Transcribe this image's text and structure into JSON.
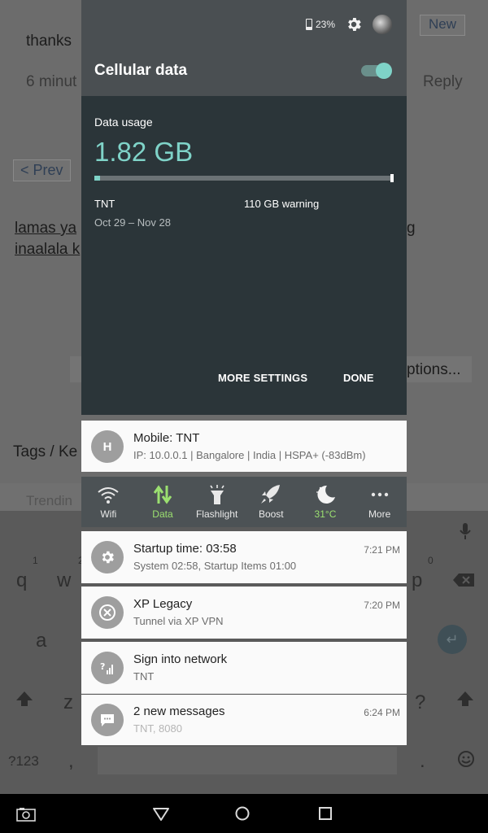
{
  "background": {
    "thanks": "thanks",
    "time_ago": "6 minut",
    "reply": "Reply",
    "new_btn": "New",
    "prev_btn": "< Prev",
    "line1_a": "lamas ya",
    "line1_b": "g",
    "line2_a": "inaalala k",
    "options": "ptions...",
    "tags": "Tags  /  Ke",
    "trending": "Trendin",
    "keyboard": {
      "row1": [
        "q",
        "w",
        "p"
      ],
      "row1_nums": [
        "1",
        "2",
        "0"
      ],
      "row2": [
        "a"
      ],
      "row3": [
        "z",
        "?"
      ],
      "row4": [
        "?123",
        ",",
        "."
      ]
    }
  },
  "status": {
    "battery_pct": "23%",
    "battery_level": 0.23
  },
  "cellular": {
    "title": "Cellular data",
    "toggle_on": true,
    "usage_label": "Data usage",
    "usage_value": "1.82 GB",
    "usage_fraction": 0.02,
    "carrier": "TNT",
    "warning": "110 GB warning",
    "period": "Oct 29 – Nov 28",
    "more_settings": "MORE SETTINGS",
    "done": "DONE"
  },
  "notif_mobile": {
    "icon_letter": "H",
    "title": "Mobile: TNT",
    "subtitle": "IP: 10.0.0.1 | Bangalore | India | HSPA+ (-83dBm)"
  },
  "tiles": [
    {
      "label": "Wifi",
      "icon": "wifi-icon",
      "active": false
    },
    {
      "label": "Data",
      "icon": "data-arrows-icon",
      "active": true
    },
    {
      "label": "Flashlight",
      "icon": "flashlight-icon",
      "active": false
    },
    {
      "label": "Boost",
      "icon": "rocket-icon",
      "active": false
    },
    {
      "label": "31°C",
      "icon": "moon-icon",
      "active": true
    },
    {
      "label": "More",
      "icon": "more-dots-icon",
      "active": false
    }
  ],
  "notifications": [
    {
      "title": "Startup time: 03:58",
      "subtitle": "System 02:58, Startup Items 01:00",
      "time": "7:21 PM",
      "icon": "gear-icon"
    },
    {
      "title": "XP Legacy",
      "subtitle": "Tunnel via XP VPN",
      "time": "7:20 PM",
      "icon": "vpn-icon"
    },
    {
      "title": "Sign into network",
      "subtitle": "TNT",
      "time": "",
      "icon": "signal-question-icon"
    },
    {
      "title": "2 new messages",
      "subtitle": "TNT, 8080",
      "time": "6:24 PM",
      "icon": "message-icon"
    }
  ]
}
